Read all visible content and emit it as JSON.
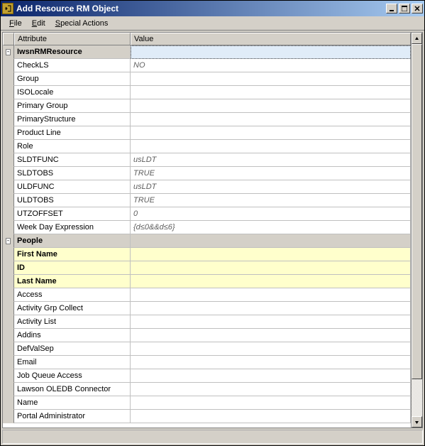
{
  "window": {
    "title": "Add Resource RM Object"
  },
  "menu": {
    "file": "File",
    "edit": "Edit",
    "special": "Special Actions"
  },
  "headers": {
    "attribute": "Attribute",
    "value": "Value"
  },
  "toggle": {
    "collapse": "-"
  },
  "sections": {
    "iwsn": "IwsnRMResource",
    "people": "People"
  },
  "rows": [
    {
      "attr": "CheckLS",
      "val": "NO",
      "italic": true
    },
    {
      "attr": "Group",
      "val": ""
    },
    {
      "attr": "ISOLocale",
      "val": ""
    },
    {
      "attr": "Primary Group",
      "val": ""
    },
    {
      "attr": "PrimaryStructure",
      "val": ""
    },
    {
      "attr": "Product Line",
      "val": ""
    },
    {
      "attr": "Role",
      "val": ""
    },
    {
      "attr": "SLDTFUNC",
      "val": "usLDT",
      "italic": true
    },
    {
      "attr": "SLDTOBS",
      "val": "TRUE",
      "italic": true
    },
    {
      "attr": "ULDFUNC",
      "val": "usLDT",
      "italic": true
    },
    {
      "attr": "ULDTOBS",
      "val": "TRUE",
      "italic": true
    },
    {
      "attr": "UTZOFFSET",
      "val": "0",
      "italic": true
    },
    {
      "attr": "Week Day Expression",
      "val": "{d≤0&&d≤6}",
      "italic": true
    }
  ],
  "people_required": [
    {
      "attr": "First Name",
      "val": ""
    },
    {
      "attr": "ID",
      "val": ""
    },
    {
      "attr": "Last Name",
      "val": ""
    }
  ],
  "people_rows": [
    {
      "attr": "Access",
      "val": ""
    },
    {
      "attr": "Activity Grp Collect",
      "val": ""
    },
    {
      "attr": "Activity List",
      "val": ""
    },
    {
      "attr": "Addins",
      "val": ""
    },
    {
      "attr": "DefValSep",
      "val": ""
    },
    {
      "attr": "Email",
      "val": ""
    },
    {
      "attr": "Job Queue Access",
      "val": ""
    },
    {
      "attr": "Lawson OLEDB Connector",
      "val": ""
    },
    {
      "attr": "Name",
      "val": ""
    },
    {
      "attr": "Portal Administrator",
      "val": ""
    }
  ]
}
